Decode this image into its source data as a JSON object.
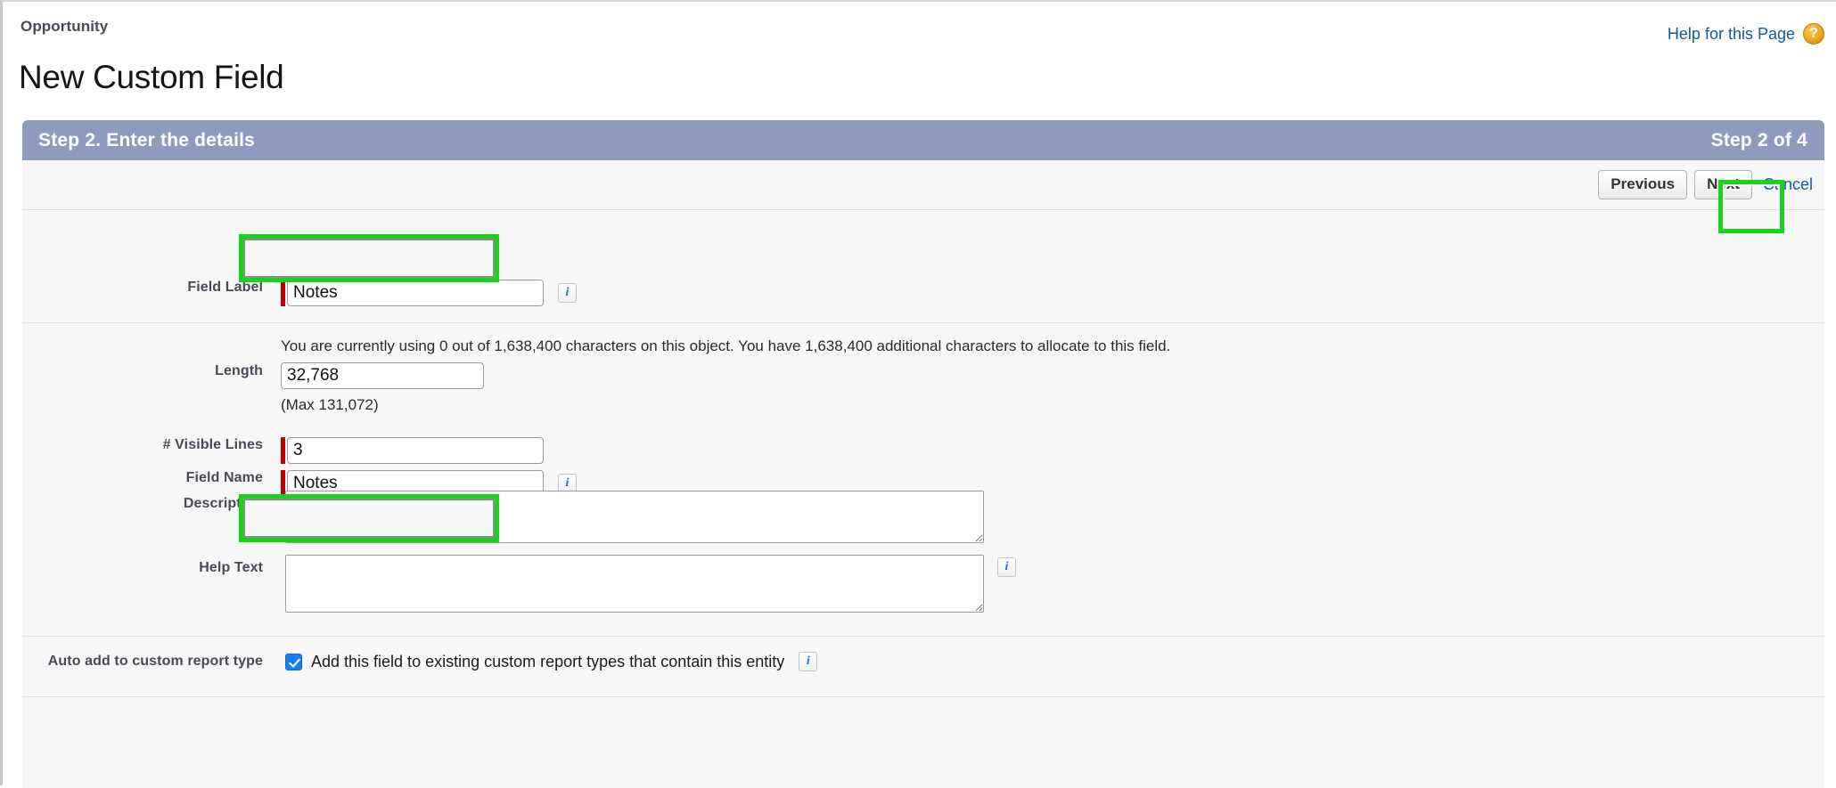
{
  "header": {
    "breadcrumb": "Opportunity",
    "title": "New Custom Field",
    "help_link": "Help for this Page",
    "help_icon": "question-orb-icon"
  },
  "wizard": {
    "step_title": "Step 2. Enter the details",
    "step_counter": "Step 2 of 4",
    "buttons": {
      "previous": "Previous",
      "next": "Next",
      "cancel": "Cancel"
    }
  },
  "form": {
    "field_label": {
      "label": "Field Label",
      "value": "Notes",
      "info_icon": "info-icon",
      "required": true
    },
    "length": {
      "label": "Length",
      "note": "You are currently using 0 out of 1,638,400 characters on this object. You have 1,638,400 additional characters to allocate to this field.",
      "value": "32,768",
      "max_note": "(Max 131,072)",
      "required": false
    },
    "visible_lines": {
      "label": "# Visible Lines",
      "value": "3",
      "required": true
    },
    "field_name": {
      "label": "Field Name",
      "value": "Notes",
      "info_icon": "info-icon",
      "required": true
    },
    "description": {
      "label": "Description",
      "value": "",
      "placeholder": ""
    },
    "help_text": {
      "label": "Help Text",
      "value": "",
      "placeholder": "",
      "info_icon": "info-icon"
    },
    "auto_add_report_type": {
      "label": "Auto add to custom report type",
      "checkbox_label": "Add this field to existing custom report types that contain this entity",
      "checked": true,
      "info_icon": "info-icon"
    }
  },
  "colors": {
    "step_bar": "#8d9bbd",
    "highlight": "#16d41a",
    "link": "#1359a5",
    "required_marker": "#c00000",
    "checkbox": "#1a7ef0",
    "help_orb": "#f0a526"
  }
}
